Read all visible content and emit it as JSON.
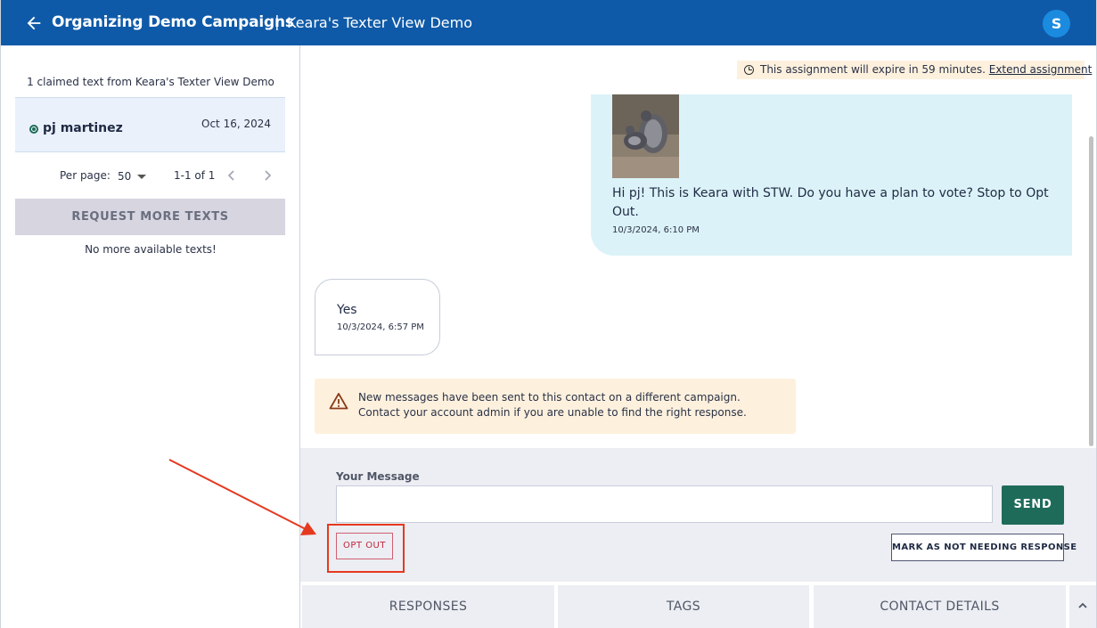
{
  "header": {
    "org_title": "Organizing Demo Campaigns",
    "separator": "|",
    "campaign_title": "Keara's Texter View Demo",
    "avatar_initial": "S",
    "back_icon": "arrow-left-icon",
    "brand_color": "#0f5aa8"
  },
  "sidebar": {
    "claimed_text": "1 claimed text from Keara's Texter View Demo",
    "contact": {
      "name": "pj martinez",
      "date": "Oct 16, 2024",
      "status_color": "#1f6b5a"
    },
    "pager": {
      "per_page_label": "Per page:",
      "per_page_value": "50",
      "range": "1-1 of 1"
    },
    "request_button": "REQUEST MORE TEXTS",
    "no_more_text": "No more available texts!"
  },
  "main": {
    "expire_banner": {
      "text": "This assignment will expire in 59 minutes.",
      "link": "Extend assignment"
    },
    "messages": [
      {
        "direction": "outgoing",
        "text": "Hi pj! This is Keara with STW. Do you have a plan to vote? Stop to Opt Out.",
        "time": "10/3/2024, 6:10 PM",
        "has_image": true
      },
      {
        "direction": "incoming",
        "text": "Yes",
        "time": "10/3/2024, 6:57 PM"
      }
    ],
    "warning": {
      "line1": "New messages have been sent to this contact on a different campaign.",
      "line2": "Contact your account admin if you are unable to find the right response."
    },
    "compose": {
      "label": "Your Message",
      "value": "",
      "send_label": "SEND",
      "opt_out_label": "OPT OUT",
      "mark_label": "MARK AS NOT NEEDING RESPONSE"
    },
    "tabs": [
      {
        "label": "RESPONSES"
      },
      {
        "label": "TAGS"
      },
      {
        "label": "CONTACT DETAILS"
      }
    ]
  },
  "colors": {
    "send": "#1f6b5a",
    "annotation": "#e5391f",
    "outgoing_bubble": "#dbf3f8",
    "warning_bg": "#fdf1de"
  }
}
